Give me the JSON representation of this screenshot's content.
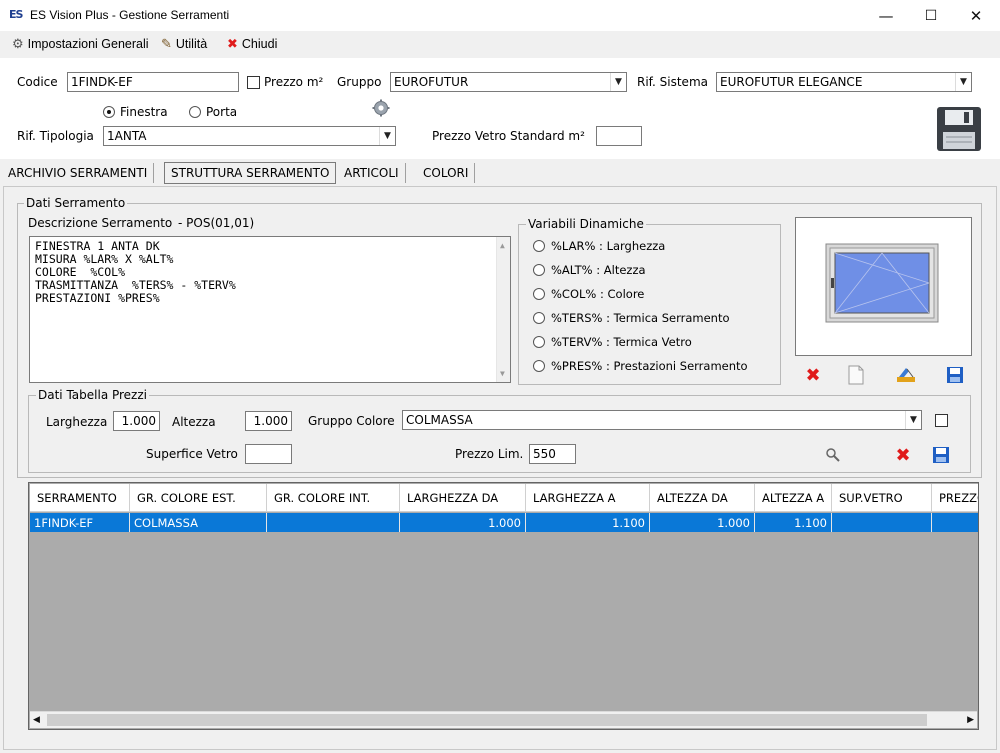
{
  "window": {
    "app_icon": "ES",
    "title": "ES Vision Plus - Gestione Serramenti",
    "minimize_glyph": "—",
    "maximize_glyph": "☐",
    "close_glyph": "✕"
  },
  "menu": [
    {
      "label": "Impostazioni Generali",
      "icon": "gear-wrench-icon",
      "glyph": "⚙"
    },
    {
      "label": "Utilità",
      "icon": "tools-icon",
      "glyph": "✎"
    },
    {
      "label": "Chiudi",
      "icon": "close-x-icon",
      "glyph": "✖"
    }
  ],
  "header": {
    "codice_label": "Codice",
    "codice_value": "1FINDK-EF",
    "prezzo_m2_label": "Prezzo m²",
    "gruppo_label": "Gruppo",
    "gruppo_value": "EUROFUTUR",
    "rif_sistema_label": "Rif. Sistema",
    "rif_sistema_value": "EUROFUTUR ELEGANCE",
    "radio_finestra": "Finestra",
    "radio_porta": "Porta",
    "rif_tipologia_label": "Rif. Tipologia",
    "rif_tipologia_value": "1ANTA",
    "prezzo_vetro_label": "Prezzo Vetro Standard m²",
    "prezzo_vetro_value": ""
  },
  "tabs": [
    "ARCHIVIO SERRAMENTI",
    "STRUTTURA SERRAMENTO",
    "ARTICOLI",
    "COLORI"
  ],
  "dati_serramento": {
    "group_title": "Dati Serramento",
    "descrizione_label": "Descrizione Serramento",
    "pos_label": "- POS(01,01)",
    "description_lines": [
      "FINESTRA 1 ANTA DK",
      "MISURA %LAR% X %ALT%",
      "COLORE  %COL%",
      "TRASMITTANZA  %TERS% - %TERV%",
      "PRESTAZIONI %PRES%"
    ]
  },
  "variabili": {
    "group_title": "Variabili Dinamiche",
    "options": [
      "%LAR% : Larghezza",
      "%ALT% : Altezza",
      "%COL% : Colore",
      "%TERS% : Termica Serramento",
      "%TERV% : Termica Vetro",
      "%PRES% : Prestazioni Serramento"
    ]
  },
  "prezzi": {
    "group_title": "Dati Tabella Prezzi",
    "larghezza_label": "Larghezza",
    "larghezza_value": "1.000",
    "altezza_label": "Altezza",
    "altezza_value": "1.000",
    "gruppo_colore_label": "Gruppo Colore",
    "gruppo_colore_value": "COLMASSA",
    "superficie_label": "Superfice Vetro",
    "superficie_value": "",
    "prezzo_lim_label": "Prezzo Lim.",
    "prezzo_lim_value": "550"
  },
  "grid": {
    "headers": [
      "SERRAMENTO",
      "GR. COLORE EST.",
      "GR. COLORE INT.",
      "LARGHEZZA DA",
      "LARGHEZZA A",
      "ALTEZZA DA",
      "ALTEZZA A",
      "SUP.VETRO",
      "PREZZO"
    ],
    "rows": [
      [
        "1FINDK-EF",
        "COLMASSA",
        "",
        "1.000",
        "1.100",
        "1.000",
        "1.100",
        "",
        ""
      ]
    ]
  },
  "colors": {
    "selection": "#0a78d7",
    "window_glass": "#6f8fe6",
    "delete_red": "#e01b1b",
    "save_blue": "#1f5fc4"
  }
}
